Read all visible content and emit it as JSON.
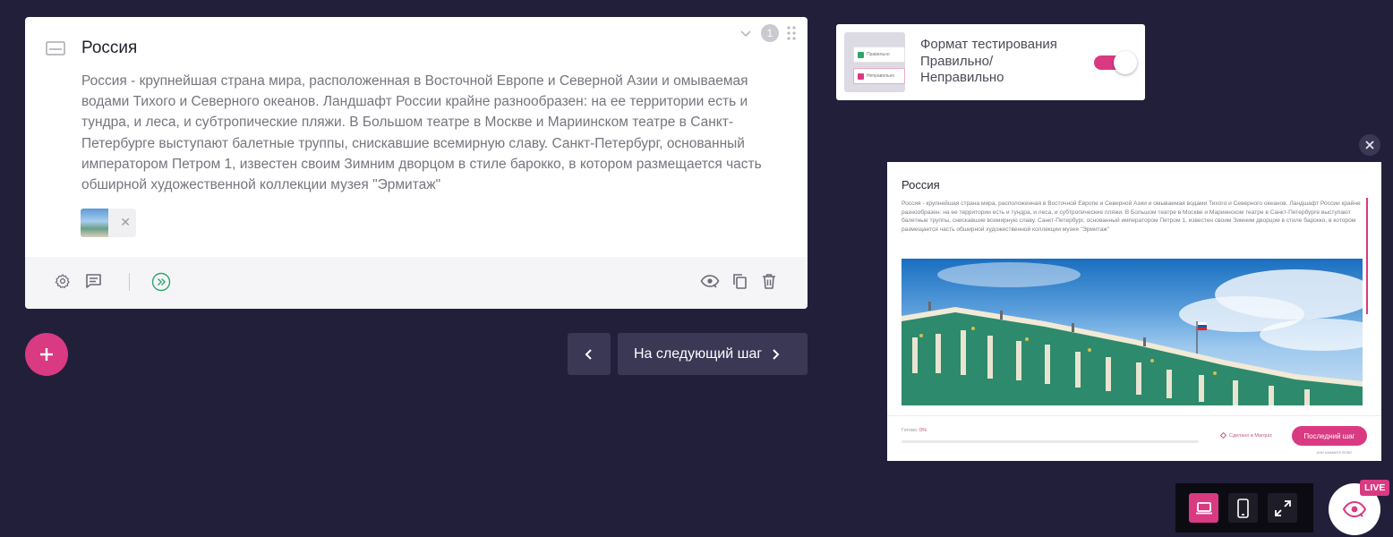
{
  "question": {
    "number": "1",
    "title": "Россия",
    "description": "Россия - крупнейшая страна мира, расположенная в Восточной Европе и Северной Азии и омываемая водами Тихого и Северного океанов. Ландшафт России крайне разнообразен: на ее территории есть и тундра, и леса, и субтропические пляжи. В Большом театре в Москве и Мариинском театре в Санкт-Петербурге выступают балетные труппы, снискавшие всемирную славу. Санкт-Петербург, основанный императором Петром 1, известен своим Зимним дворцом в стиле барокко, в котором размещается часть обширной художественной коллекции музея \"Эрмитаж\""
  },
  "navigation": {
    "next_label": "На следующий шаг"
  },
  "format": {
    "label": "Формат тестирования Правильно/ Неправильно",
    "thumb_correct": "Правильно",
    "thumb_incorrect": "Неправильно",
    "enabled": true
  },
  "preview": {
    "title": "Россия",
    "text": "Россия - крупнейшая страна мира, расположенная в Восточной Европе и Северной Азии и омываемая водами Тихого и Северного океанов. Ландшафт России крайне разнообразен: на ее территории есть и тундра, и леса, и субтропические пляжи. В Большом театре в Москве и Мариинском театре в Санкт-Петербурге выступают балетные труппы, снискавшие всемирную славу. Санкт-Петербург, основанный императором Петром 1, известен своим Зимним дворцом в стиле барокко, в котором размещается часть обширной художественной коллекции музея \"Эрмитаж\"",
    "progress_label": "Готово:",
    "progress_value": "0%",
    "progress_fraction": 0,
    "made_in": "Сделано в Marquiz",
    "last_step_label": "Последний шаг",
    "enter_hint": "или нажмите Enter"
  },
  "live_badge": "LIVE",
  "colors": {
    "background": "#221f3b",
    "accent": "#d93a82",
    "button_dark": "#3a3855"
  }
}
